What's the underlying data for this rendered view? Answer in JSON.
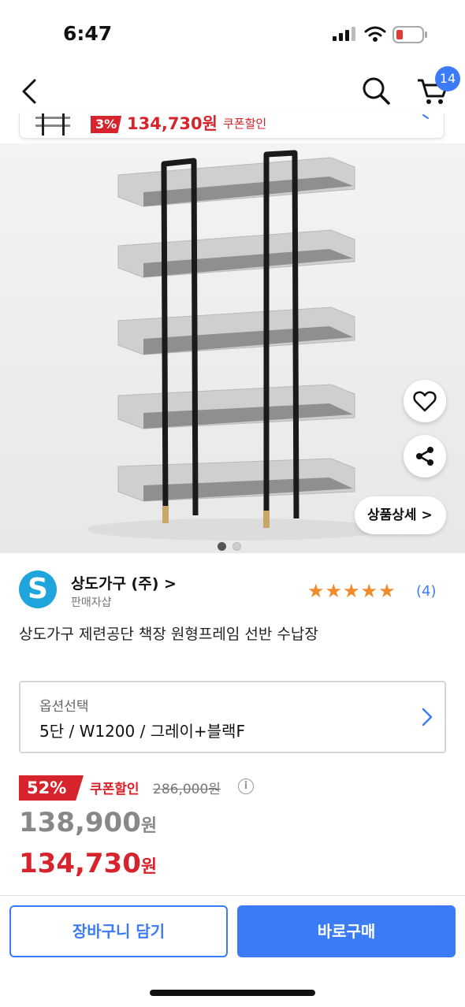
{
  "status_bar": {
    "time": "6:47",
    "icons": [
      "signal-icon",
      "wifi-icon",
      "battery-low-icon"
    ]
  },
  "nav": {
    "icons": [
      "back-icon",
      "search-icon",
      "cart-icon"
    ],
    "cart_count": "14"
  },
  "mini_bar": {
    "discount": "3%",
    "price": "134,730원",
    "coupon": "쿠폰할인"
  },
  "gallery": {
    "detail_button": "상품상세 >",
    "page_count": 2,
    "current_page": 1
  },
  "seller": {
    "logo_letter": "S",
    "name": "상도가구 (주) >",
    "type": "판매자샵",
    "stars": "★★★★★",
    "rating": 5,
    "reviews": "(4)"
  },
  "product": {
    "title": "상도가구 제련공단 책장 원형프레임 선반 수납장"
  },
  "option": {
    "label": "옵션선택",
    "value": "5단 / W1200 / 그레이+블랙F"
  },
  "price": {
    "discount": "52%",
    "coupon_label": "쿠폰할인",
    "original": "286,000원",
    "info_glyph": "i",
    "sale_amount": "138,900",
    "coupon_amount": "134,730",
    "won": "원"
  },
  "actions": {
    "add_to_cart": "장바구니 담기",
    "buy_now": "바로구매"
  },
  "colors": {
    "accent": "#3b7cf6",
    "sale": "#d7232b",
    "star": "#f08a2a"
  }
}
